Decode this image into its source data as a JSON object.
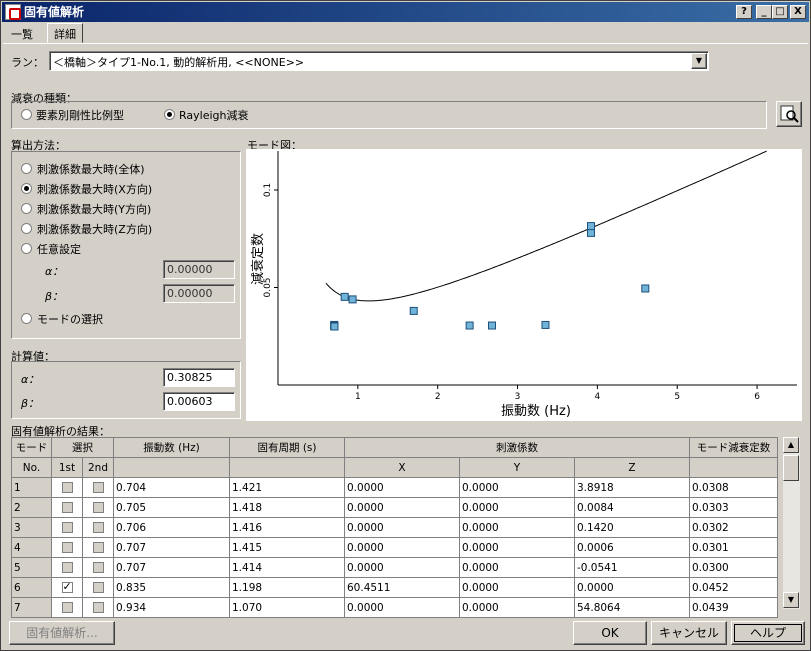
{
  "window": {
    "title": "固有値解析",
    "help_btn": "?",
    "min_btn": "_",
    "max_btn": "□",
    "close_btn": "X"
  },
  "tabs": [
    {
      "label": "一覧"
    },
    {
      "label": "詳細"
    }
  ],
  "run": {
    "label": "ラン：",
    "value": "＜橋軸＞タイプ1-No.1, 動的解析用, <<NONE>>"
  },
  "damping": {
    "label": "減衰の種類：",
    "options": [
      "要素別剛性比例型",
      "Rayleigh減衰"
    ],
    "selected": 1
  },
  "method": {
    "label": "算出方法：",
    "options": [
      "刺激係数最大時(全体)",
      "刺激係数最大時(X方向)",
      "刺激係数最大時(Y方向)",
      "刺激係数最大時(Z方向)",
      "任意設定",
      "モードの選択"
    ],
    "selected": 1,
    "alpha_label": "α：",
    "alpha_value": "0.00000",
    "beta_label": "β：",
    "beta_value": "0.00000"
  },
  "computed": {
    "label": "計算値：",
    "alpha_label": "α：",
    "alpha_value": "0.30825",
    "beta_label": "β：",
    "beta_value": "0.00603"
  },
  "mode_chart": {
    "label": "モード図："
  },
  "chart_data": {
    "type": "scatter",
    "xlabel": "振動数 (Hz)",
    "ylabel": "減衰定数",
    "xlim": [
      0,
      6.5
    ],
    "ylim": [
      0,
      0.12
    ],
    "x_ticks": [
      1,
      2,
      3,
      4,
      5,
      6
    ],
    "y_ticks": [
      0.05,
      0.1
    ],
    "points": [
      {
        "x": 0.704,
        "y": 0.0308
      },
      {
        "x": 0.705,
        "y": 0.0303
      },
      {
        "x": 0.706,
        "y": 0.0302
      },
      {
        "x": 0.707,
        "y": 0.0301
      },
      {
        "x": 0.707,
        "y": 0.03
      },
      {
        "x": 0.835,
        "y": 0.0452
      },
      {
        "x": 0.934,
        "y": 0.0439
      },
      {
        "x": 1.7,
        "y": 0.038
      },
      {
        "x": 2.4,
        "y": 0.0305
      },
      {
        "x": 2.68,
        "y": 0.0305
      },
      {
        "x": 3.35,
        "y": 0.0308
      },
      {
        "x": 3.92,
        "y": 0.078
      },
      {
        "x": 3.92,
        "y": 0.0815
      },
      {
        "x": 4.6,
        "y": 0.0495
      }
    ],
    "curve": {
      "alpha": 0.30825,
      "beta": 0.00603
    }
  },
  "results": {
    "label": "固有値解析の結果：",
    "headers": {
      "mode": "モード",
      "select": "選択",
      "freq": "振動数 (Hz)",
      "period": "固有周期 (s)",
      "stim": "刺激係数",
      "damp": "モード減衰定数",
      "no": "No.",
      "first": "1st",
      "second": "2nd",
      "x": "X",
      "y": "Y",
      "z": "Z"
    },
    "rows": [
      {
        "no": "1",
        "c1": false,
        "c2": false,
        "freq": "0.704",
        "period": "1.421",
        "x": "0.0000",
        "y": "0.0000",
        "z": "3.8918",
        "damp": "0.0308"
      },
      {
        "no": "2",
        "c1": false,
        "c2": false,
        "freq": "0.705",
        "period": "1.418",
        "x": "0.0000",
        "y": "0.0000",
        "z": "0.0084",
        "damp": "0.0303"
      },
      {
        "no": "3",
        "c1": false,
        "c2": false,
        "freq": "0.706",
        "period": "1.416",
        "x": "0.0000",
        "y": "0.0000",
        "z": "0.1420",
        "damp": "0.0302"
      },
      {
        "no": "4",
        "c1": false,
        "c2": false,
        "freq": "0.707",
        "period": "1.415",
        "x": "0.0000",
        "y": "0.0000",
        "z": "0.0006",
        "damp": "0.0301"
      },
      {
        "no": "5",
        "c1": false,
        "c2": false,
        "freq": "0.707",
        "period": "1.414",
        "x": "0.0000",
        "y": "0.0000",
        "z": "-0.0541",
        "damp": "0.0300"
      },
      {
        "no": "6",
        "c1": true,
        "c2": false,
        "freq": "0.835",
        "period": "1.198",
        "x": "60.4511",
        "y": "0.0000",
        "z": "0.0000",
        "damp": "0.0452"
      },
      {
        "no": "7",
        "c1": false,
        "c2": false,
        "freq": "0.934",
        "period": "1.070",
        "x": "0.0000",
        "y": "0.0000",
        "z": "54.8064",
        "damp": "0.0439"
      }
    ]
  },
  "buttons": {
    "analyze": "固有値解析...",
    "ok": "OK",
    "cancel": "キャンセル",
    "help": "ヘルプ"
  }
}
